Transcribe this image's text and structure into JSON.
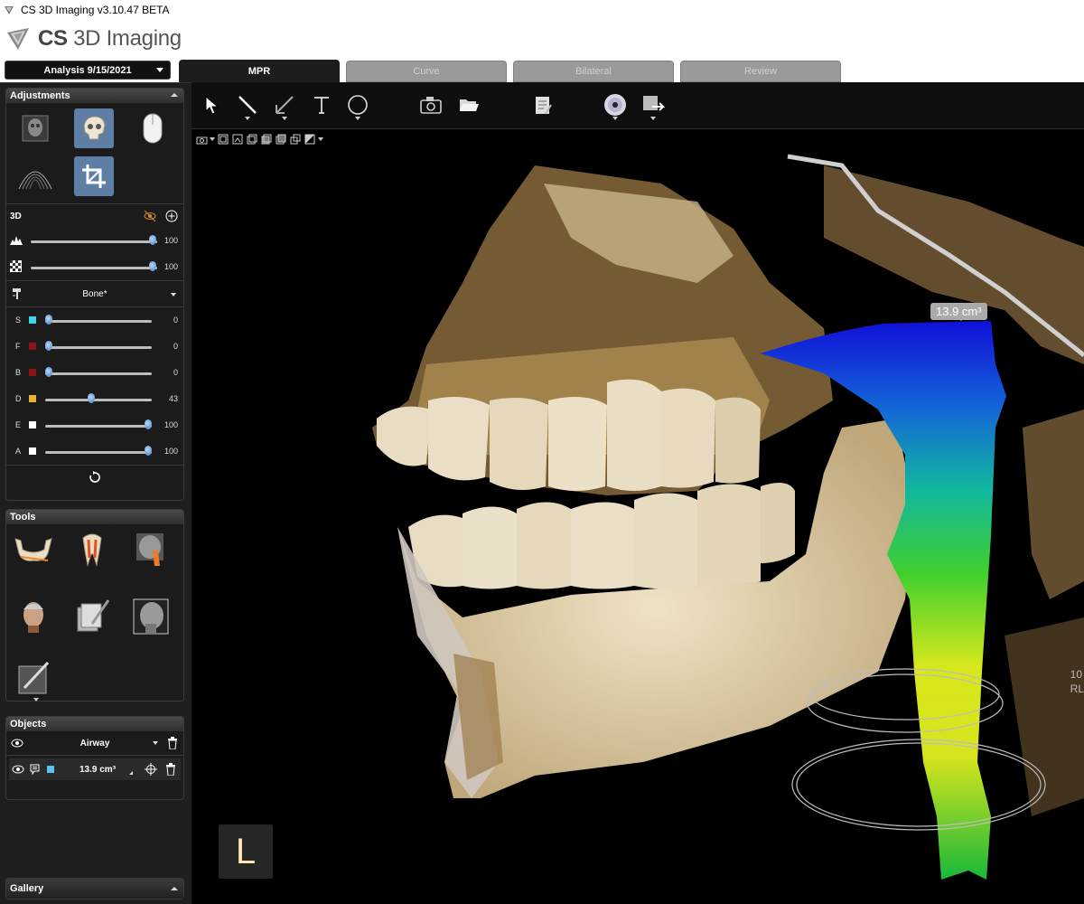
{
  "titlebar": {
    "title": "CS 3D Imaging v3.10.47 BETA"
  },
  "header": {
    "logo_bold": "CS",
    "logo_rest": " 3D Imaging"
  },
  "analysis": {
    "label": "Analysis 9/15/2021"
  },
  "tabs": [
    {
      "label": "MPR",
      "active": true
    },
    {
      "label": "Curve",
      "active": false
    },
    {
      "label": "Bilateral",
      "active": false
    },
    {
      "label": "Review",
      "active": false
    }
  ],
  "adjustments": {
    "title": "Adjustments",
    "section_3d": "3D",
    "sliders_top": [
      {
        "icon": "histogram-icon",
        "value": "100",
        "fraction": 1.0
      },
      {
        "icon": "checker-icon",
        "value": "100",
        "fraction": 1.0
      }
    ],
    "preset": "Bone*",
    "color_sliders": [
      {
        "label": "S",
        "color": "#3fd3e8",
        "value": "0",
        "fraction": 0.0
      },
      {
        "label": "F",
        "color": "#8b1414",
        "value": "0",
        "fraction": 0.0
      },
      {
        "label": "B",
        "color": "#8b1414",
        "value": "0",
        "fraction": 0.0
      },
      {
        "label": "D",
        "color": "#e8b22e",
        "value": "43",
        "fraction": 0.43
      },
      {
        "label": "E",
        "color": "#ffffff",
        "value": "100",
        "fraction": 1.0
      },
      {
        "label": "A",
        "color": "#ffffff",
        "value": "100",
        "fraction": 1.0
      }
    ]
  },
  "tools": {
    "title": "Tools"
  },
  "objects": {
    "title": "Objects",
    "group": "Airway",
    "item_value": "13.9 cm³",
    "item_color": "#5bc2f0"
  },
  "gallery": {
    "title": "Gallery"
  },
  "viewer": {
    "volume_label": "13.9 cm³",
    "orientation": "L",
    "edge_line1": "10",
    "edge_line2": "RL"
  },
  "colors": {
    "accent_selected": "#5e7fa5",
    "panel_bg": "#1b1b1b",
    "viewer_bg": "#000000"
  }
}
